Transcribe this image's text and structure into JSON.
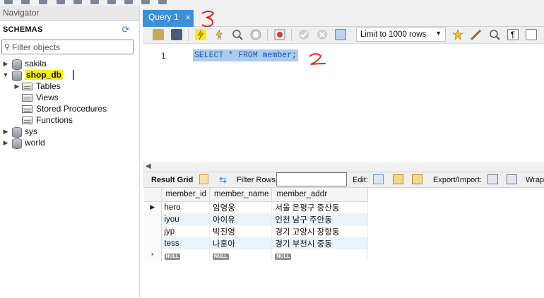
{
  "navigator": {
    "header": "Navigator",
    "schemas_title": "SCHEMAS",
    "filter_placeholder": "Filter objects",
    "schemas": [
      {
        "name": "sakila",
        "expanded": false
      },
      {
        "name": "shop_db",
        "expanded": true,
        "children": [
          "Tables",
          "Views",
          "Stored Procedures",
          "Functions"
        ]
      },
      {
        "name": "sys",
        "expanded": false
      },
      {
        "name": "world",
        "expanded": false
      }
    ]
  },
  "editor": {
    "tab_label": "Query 1",
    "tab_close": "×",
    "limit_option": "Limit to 1000 rows",
    "line_number": "1",
    "sql": "SELECT * FROM member;"
  },
  "results": {
    "result_grid_label": "Result Grid",
    "filter_rows_label": "Filter Rows:",
    "edit_label": "Edit:",
    "export_import_label": "Export/Import:",
    "wrap_label": "Wrap",
    "columns": [
      "member_id",
      "member_name",
      "member_addr"
    ],
    "rows": [
      [
        "hero",
        "임영웅",
        "서울 은평구 증산동"
      ],
      [
        "iyou",
        "아이유",
        "인천 남구 주안동"
      ],
      [
        "jyp",
        "박진영",
        "경기 고양시 장항동"
      ],
      [
        "tess",
        "나훈아",
        "경기 부천시 중동"
      ]
    ],
    "null_label": "NULL",
    "new_row_marker": "*",
    "current_row_marker": "▶"
  },
  "annotations": {
    "mark_2": "2",
    "mark_3": "3",
    "color_red": "#e22222",
    "color_highlight": "#f7ef12"
  }
}
